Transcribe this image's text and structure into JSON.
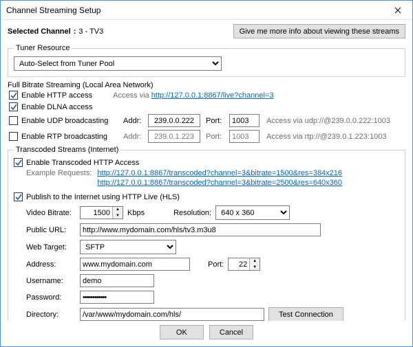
{
  "window_title": "Channel Streaming Setup",
  "selected_channel_label": "Selected Channel",
  "selected_channel_value": "3 - TV3",
  "more_info_button": "Give me more info about viewing these streams",
  "tuner": {
    "legend": "Tuner Resource",
    "value": "Auto-Select from Tuner Pool"
  },
  "lan": {
    "heading": "Full Bitrate Streaming (Local Area Network)",
    "http": {
      "label": "Enable HTTP access",
      "checked": true,
      "note": "Access via ",
      "link": "http://127.0.0.1:8867/live?channel=3"
    },
    "dlna": {
      "label": "Enable DLNA access",
      "checked": true
    },
    "udp": {
      "label": "Enable UDP broadcasting",
      "checked": false,
      "addr_label": "Addr:",
      "addr": "239.0.0.222",
      "port_label": "Port:",
      "port": "1003",
      "note": "Access via udp://@239.0.0.222:1003"
    },
    "rtp": {
      "label": "Enable RTP broadcasting",
      "checked": false,
      "addr_label": "Addr:",
      "addr": "239.0.1.223",
      "port_label": "Port:",
      "port": "1003",
      "note": "Access via rtp://@239.0.1.223:1003"
    }
  },
  "transcoded": {
    "legend": "Transcoded Streams (Internet)",
    "enable": {
      "label": "Enable Transcoded HTTP Access",
      "checked": true
    },
    "examples_label": "Example Requests:",
    "example1": "http://127.0.0.1:8867/transcoded?channel=3&bitrate=1500&res=384x216",
    "example2": "http://127.0.0.1:8867/transcoded?channel=3&bitrate=2500&res=640x360",
    "hls": {
      "label": "Publish to the Internet using HTTP Live (HLS)",
      "checked": true,
      "bitrate_label": "Video Bitrate:",
      "bitrate": "1500",
      "bitrate_unit": "Kbps",
      "resolution_label": "Resolution:",
      "resolution": "640 x 360",
      "public_url_label": "Public URL:",
      "public_url": "http://www.mydomain.com/hls/tv3.m3u8",
      "web_target_label": "Web Target:",
      "web_target": "SFTP",
      "address_label": "Address:",
      "address": "www.mydomain.com",
      "port_label": "Port:",
      "port": "22",
      "username_label": "Username:",
      "username": "demo",
      "password_label": "Password:",
      "password": "••••••••••••",
      "directory_label": "Directory:",
      "directory": "/var/www/mydomain.com/hls/",
      "test_button": "Test Connection"
    }
  },
  "buttons": {
    "ok": "OK",
    "cancel": "Cancel"
  }
}
